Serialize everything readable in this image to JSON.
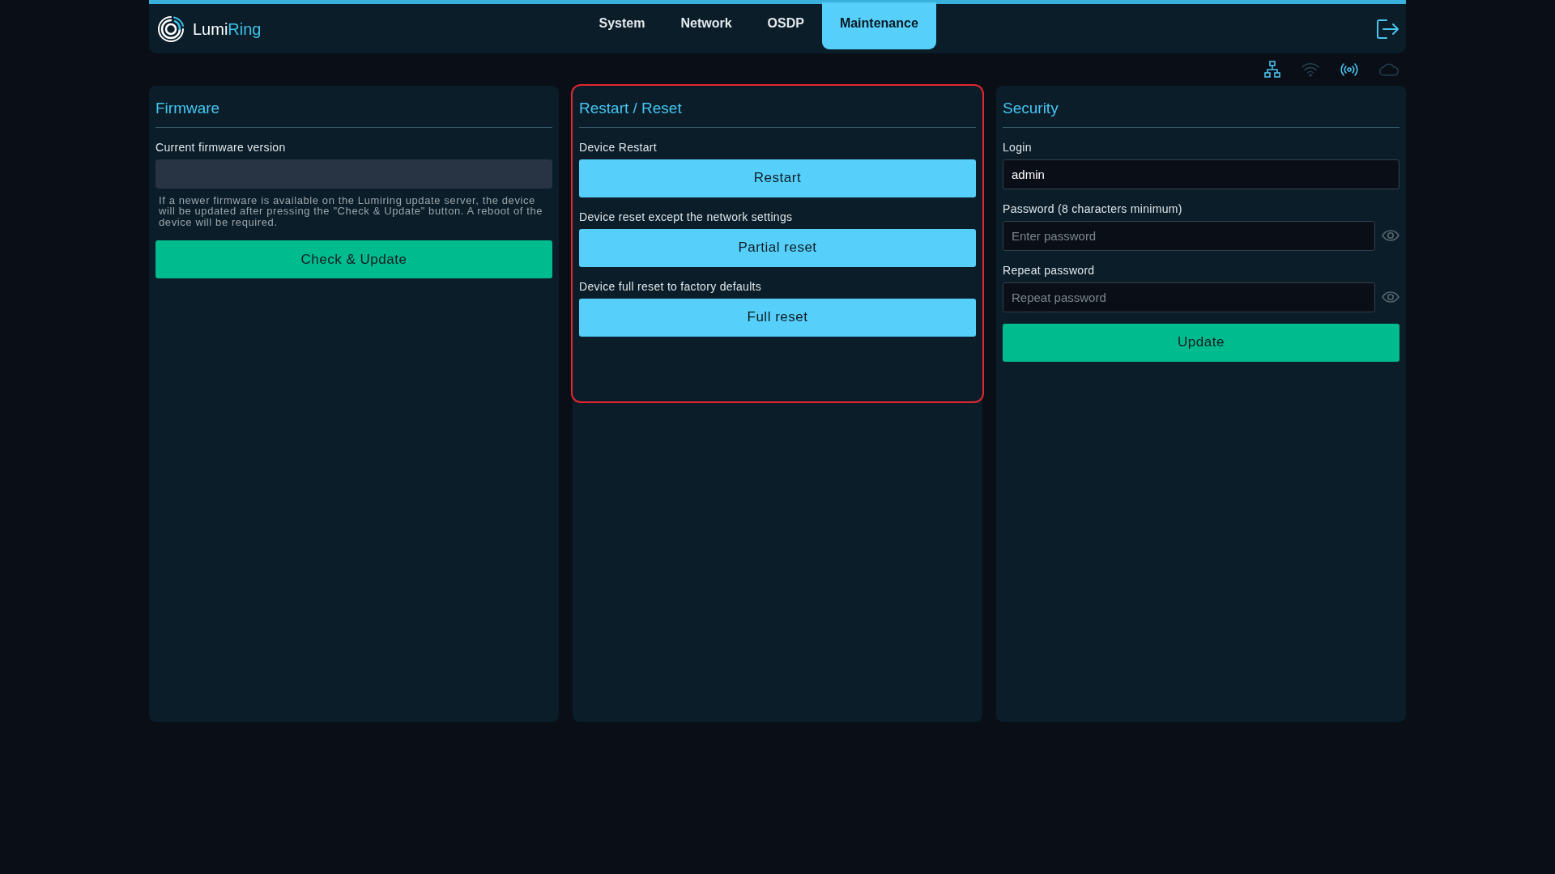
{
  "header": {
    "logo": {
      "first": "Lumi",
      "second": "Ring"
    },
    "tabs": [
      {
        "label": "System",
        "selected": false
      },
      {
        "label": "Network",
        "selected": false
      },
      {
        "label": "OSDP",
        "selected": false
      },
      {
        "label": "Maintenance",
        "selected": true
      }
    ]
  },
  "status_icons": [
    {
      "kind": "network",
      "active": true
    },
    {
      "kind": "wifi",
      "active": false
    },
    {
      "kind": "broadcast",
      "active": true
    },
    {
      "kind": "cloud",
      "active": false
    }
  ],
  "panels": [
    {
      "title": "Firmware",
      "highlighted": false,
      "items": [
        {
          "kind": "label",
          "text": "Current firmware version"
        },
        {
          "kind": "readonly",
          "value": ""
        },
        {
          "kind": "note",
          "text": "If a newer firmware is available on the Lumiring update server, the device will be updated after pressing the \"Check & Update\" button. A reboot of the device will be required."
        },
        {
          "kind": "green-button",
          "text": "Check & Update"
        }
      ]
    },
    {
      "title": "Restart / Reset",
      "highlighted": true,
      "items": [
        {
          "kind": "label",
          "text": "Device Restart"
        },
        {
          "kind": "blue-button",
          "text": "Restart"
        },
        {
          "kind": "label",
          "text": "Device reset except the network settings"
        },
        {
          "kind": "blue-button",
          "text": "Partial reset"
        },
        {
          "kind": "label",
          "text": "Device full reset to factory defaults"
        },
        {
          "kind": "blue-button",
          "text": "Full reset"
        }
      ]
    },
    {
      "title": "Security",
      "highlighted": false,
      "items": [
        {
          "kind": "label",
          "text": "Login"
        },
        {
          "kind": "input",
          "value": "admin"
        },
        {
          "kind": "label",
          "text": "Password (8 characters minimum)"
        },
        {
          "kind": "password",
          "placeholder": "Enter password"
        },
        {
          "kind": "label",
          "text": "Repeat password"
        },
        {
          "kind": "password",
          "placeholder": "Repeat password"
        },
        {
          "kind": "green-button",
          "text": "Update"
        }
      ]
    }
  ]
}
